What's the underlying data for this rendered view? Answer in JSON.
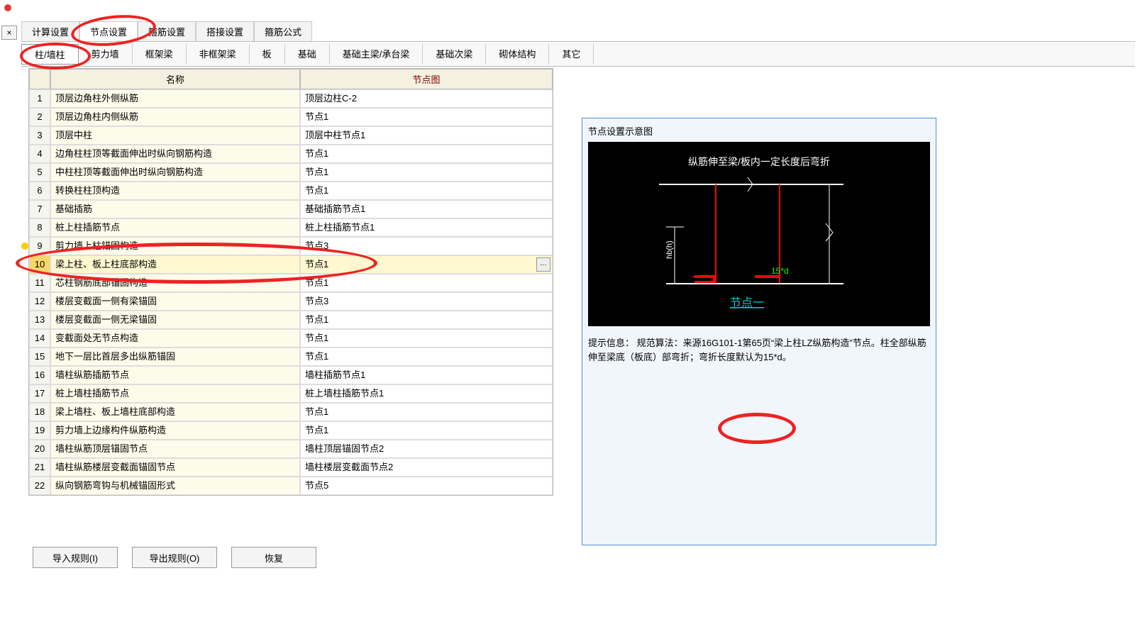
{
  "window": {
    "close": "×"
  },
  "topTabs": [
    "计算设置",
    "节点设置",
    "箍筋设置",
    "搭接设置",
    "箍筋公式"
  ],
  "topActive": 1,
  "subTabs": [
    "柱/墙柱",
    "剪力墙",
    "框架梁",
    "非框架梁",
    "板",
    "基础",
    "基础主梁/承台梁",
    "基础次梁",
    "砌体结构",
    "其它"
  ],
  "subActive": 0,
  "gridHead": {
    "name": "名称",
    "node": "节点图"
  },
  "rows": [
    {
      "n": 1,
      "name": "顶层边角柱外侧纵筋",
      "node": "顶层边柱C-2"
    },
    {
      "n": 2,
      "name": "顶层边角柱内侧纵筋",
      "node": "节点1"
    },
    {
      "n": 3,
      "name": "顶层中柱",
      "node": "顶层中柱节点1"
    },
    {
      "n": 4,
      "name": "边角柱柱顶等截面伸出时纵向钢筋构造",
      "node": "节点1"
    },
    {
      "n": 5,
      "name": "中柱柱顶等截面伸出时纵向钢筋构造",
      "node": "节点1"
    },
    {
      "n": 6,
      "name": "转换柱柱顶构造",
      "node": "节点1"
    },
    {
      "n": 7,
      "name": "基础插筋",
      "node": "基础插筋节点1"
    },
    {
      "n": 8,
      "name": "桩上柱插筋节点",
      "node": "桩上柱插筋节点1"
    },
    {
      "n": 9,
      "name": "剪力墙上柱锚固构造",
      "node": "节点3"
    },
    {
      "n": 10,
      "name": "梁上柱、板上柱底部构造",
      "node": "节点1",
      "selected": true
    },
    {
      "n": 11,
      "name": "芯柱钢筋底部锚固构造",
      "node": "节点1"
    },
    {
      "n": 12,
      "name": "楼层变截面一侧有梁锚固",
      "node": "节点3"
    },
    {
      "n": 13,
      "name": "楼层变截面一侧无梁锚固",
      "node": "节点1"
    },
    {
      "n": 14,
      "name": "变截面处无节点构造",
      "node": "节点1"
    },
    {
      "n": 15,
      "name": "地下一层比首层多出纵筋锚固",
      "node": "节点1"
    },
    {
      "n": 16,
      "name": "墙柱纵筋插筋节点",
      "node": "墙柱插筋节点1"
    },
    {
      "n": 17,
      "name": "桩上墙柱插筋节点",
      "node": "桩上墙柱插筋节点1"
    },
    {
      "n": 18,
      "name": "梁上墙柱、板上墙柱底部构造",
      "node": "节点1"
    },
    {
      "n": 19,
      "name": "剪力墙上边缘构件纵筋构造",
      "node": "节点1"
    },
    {
      "n": 20,
      "name": "墙柱纵筋顶层锚固节点",
      "node": "墙柱顶层锚固节点2"
    },
    {
      "n": 21,
      "name": "墙柱纵筋楼层变截面锚固节点",
      "node": "墙柱楼层变截面节点2"
    },
    {
      "n": 22,
      "name": "纵向钢筋弯钩与机械锚固形式",
      "node": "节点5"
    }
  ],
  "rightPanel": {
    "title": "节点设置示意图",
    "diagramTitle": "纵筋伸至梁/板内一定长度后弯折",
    "hbLabel": "hb(h)",
    "bendLabel": "15*d",
    "nodeLabel": "节点一",
    "hintPrefix": "提示信息：",
    "hint": "规范算法：来源16G101-1第65页“梁上柱LZ纵筋构造”节点。柱全部纵筋伸至梁底（板底）部弯折；弯折长度默认为15*d。"
  },
  "buttons": {
    "import": "导入规则(I)",
    "export": "导出规则(O)",
    "restore": "恢复"
  }
}
